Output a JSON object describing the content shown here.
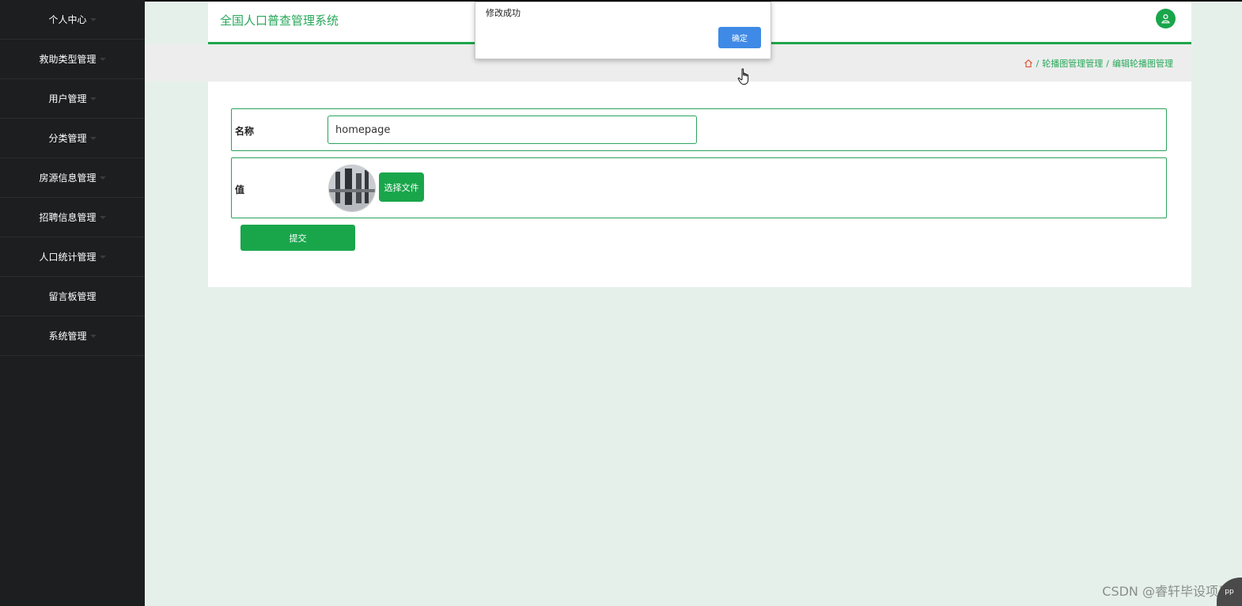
{
  "sidebar": {
    "items": [
      {
        "label": "个人中心"
      },
      {
        "label": "救助类型管理"
      },
      {
        "label": "用户管理"
      },
      {
        "label": "分类管理"
      },
      {
        "label": "房源信息管理"
      },
      {
        "label": "招聘信息管理"
      },
      {
        "label": "人口统计管理"
      },
      {
        "label": "留言板管理"
      },
      {
        "label": "系统管理"
      }
    ]
  },
  "header": {
    "title": "全国人口普查管理系统"
  },
  "breadcrumb": {
    "items": [
      "轮播图管理管理",
      "编辑轮播图管理"
    ]
  },
  "form": {
    "name_label": "名称",
    "name_value": "homepage",
    "value_label": "值",
    "choose_file_label": "选择文件",
    "submit_label": "提交"
  },
  "alert": {
    "message": "修改成功",
    "ok_label": "确定"
  },
  "watermark": {
    "text": "CSDN @睿轩毕设项目",
    "badge": "pp"
  },
  "colors": {
    "accent": "#19a64b",
    "sidebar": "#1d1e20",
    "alert_button": "#3e8ae6"
  }
}
